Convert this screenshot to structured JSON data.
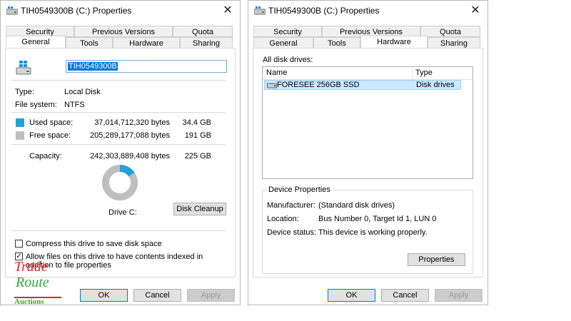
{
  "left": {
    "title": "TIH0549300B (C:) Properties",
    "tabs_row1": [
      "Security",
      "Previous Versions",
      "Quota"
    ],
    "tabs_row2": [
      "General",
      "Tools",
      "Hardware",
      "Sharing"
    ],
    "active_tab": "General",
    "drive_label_value": "TIH0549300B",
    "type_label": "Type:",
    "type_value": "Local Disk",
    "fs_label": "File system:",
    "fs_value": "NTFS",
    "used_label": "Used space:",
    "used_bytes": "37,014,712,320 bytes",
    "used_gb": "34.4 GB",
    "free_label": "Free space:",
    "free_bytes": "205,289,177,088 bytes",
    "free_gb": "191 GB",
    "capacity_label": "Capacity:",
    "capacity_bytes": "242,303,889,408 bytes",
    "capacity_gb": "225 GB",
    "used_fraction": 0.153,
    "drive_caption": "Drive C:",
    "disk_cleanup": "Disk Cleanup",
    "compress_label": "Compress this drive to save disk space",
    "compress_checked": false,
    "index_label": "Allow files on this drive to have contents indexed in addition to file properties",
    "index_checked": true,
    "ok": "OK",
    "cancel": "Cancel",
    "apply": "Apply"
  },
  "right": {
    "title": "TIH0549300B (C:) Properties",
    "tabs_row1": [
      "Security",
      "Previous Versions",
      "Quota"
    ],
    "tabs_row2": [
      "General",
      "Tools",
      "Hardware",
      "Sharing"
    ],
    "active_tab": "Hardware",
    "all_disk_drives": "All disk drives:",
    "col_name": "Name",
    "col_type": "Type",
    "drive_name": "FORESEE 256GB SSD",
    "drive_type": "Disk drives",
    "device_properties": "Device Properties",
    "manufacturer_label": "Manufacturer:",
    "manufacturer_value": "(Standard disk drives)",
    "location_label": "Location:",
    "location_value": "Bus Number 0, Target Id 1, LUN 0",
    "status_label": "Device status:",
    "status_value": "This device is working properly.",
    "properties_btn": "Properties",
    "ok": "OK",
    "cancel": "Cancel",
    "apply": "Apply"
  },
  "logo": {
    "line1": "Trade",
    "line2": "Route",
    "line3": "Auctions"
  },
  "colors": {
    "used": "#26a0da",
    "free": "#bfbfbf",
    "selection": "#0078d7",
    "logo_red": "#e4262a",
    "logo_green": "#2eaa3a"
  },
  "icons": {
    "title": "drive-icon",
    "close": "close-icon",
    "drive_large": "drive-icon",
    "disk_row": "disk-drive-icon"
  }
}
